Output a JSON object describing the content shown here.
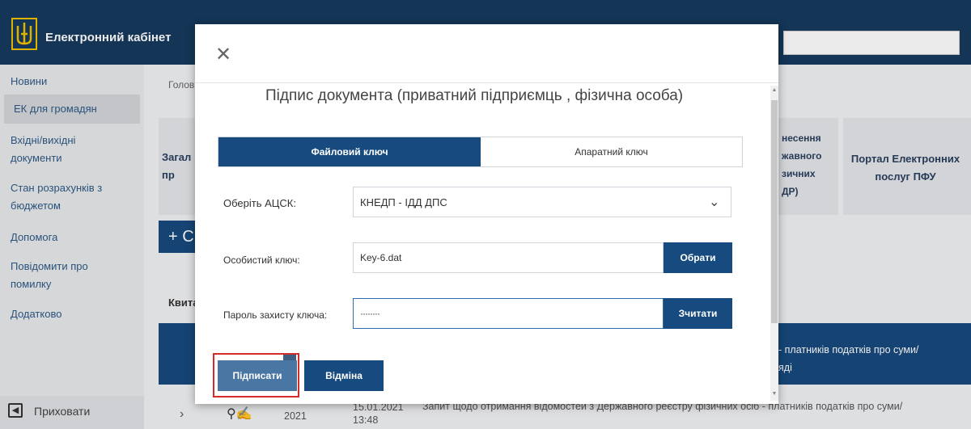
{
  "app": {
    "title": "Електронний кабінет"
  },
  "sidebar": {
    "items": [
      {
        "label": "Новини"
      },
      {
        "label": "ЕК для громадян"
      },
      {
        "label": "Вхідні/вихідні документи"
      },
      {
        "label": "Стан розрахунків з бюджетом"
      },
      {
        "label": "Допомога"
      },
      {
        "label": "Повідомити про помилку"
      },
      {
        "label": "Додатково"
      }
    ],
    "hide_label": "Приховати"
  },
  "main": {
    "breadcrumb": "Голов",
    "cards": [
      {
        "label": "Загал\nпр"
      },
      {
        "label": "несення\nжавного\nзичних\nДР)"
      },
      {
        "label": "Портал Електронних\nпослуг ПФУ"
      }
    ],
    "create_button": "+ С",
    "section_label": "Квита",
    "table_header": "- платників податків про суми/\nяді",
    "row": {
      "date": "15.01.2021\n13:48",
      "year": "2021",
      "text": "Запит щодо отримання відомостей з Державного реєстру фізичних осіб - платників податків про суми/"
    }
  },
  "modal": {
    "title": "Підпис документа (приватний підприємць , фізична особа)",
    "tabs": [
      {
        "label": "Файловий ключ"
      },
      {
        "label": "Апаратний ключ"
      }
    ],
    "fields": {
      "acsk_label": "Оберіть АЦСК:",
      "acsk_value": "КНЕДП - ІДД ДПС",
      "key_label": "Особистий ключ:",
      "key_value": "Key-6.dat",
      "key_button": "Обрати",
      "password_label": "Пароль захисту ключа:",
      "password_value": "········",
      "password_button": "Зчитати"
    },
    "sign_button": "Підписати",
    "cancel_button": "Відміна"
  },
  "colors": {
    "primary": "#174a7e",
    "header": "#163a5e",
    "highlight": "#d62b2b"
  }
}
